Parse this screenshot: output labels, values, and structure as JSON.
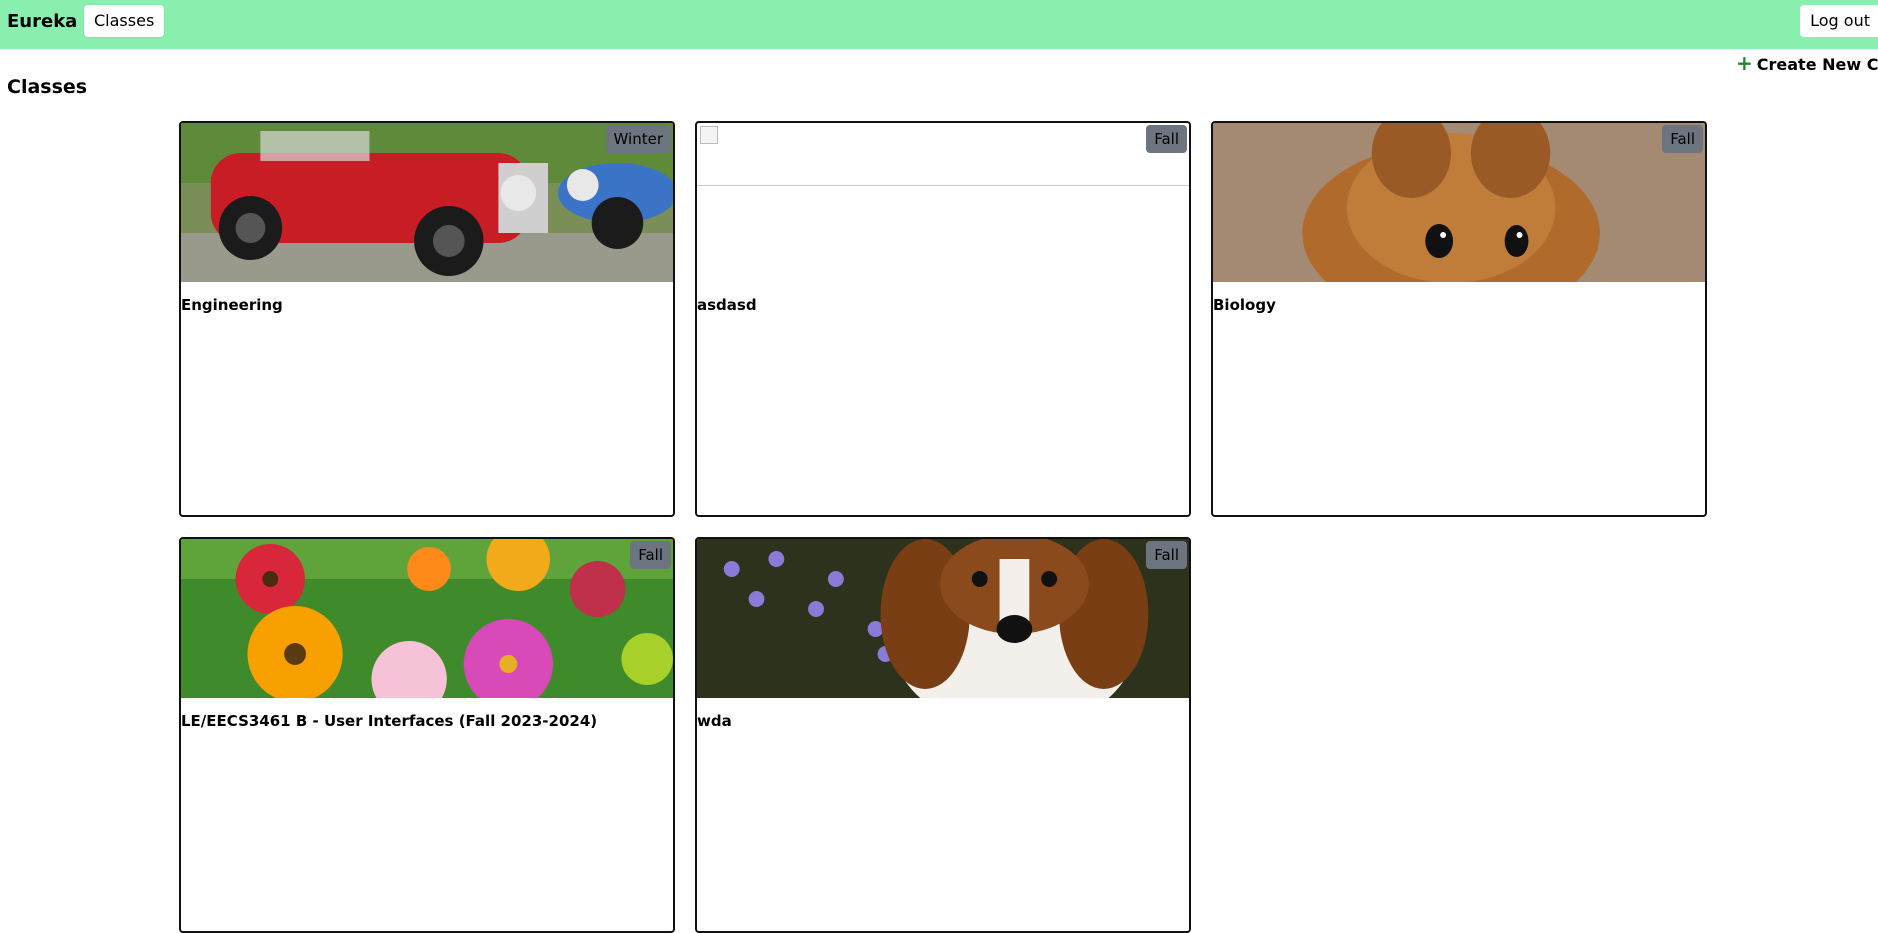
{
  "navbar": {
    "brand": "Eureka",
    "classes_link": "Classes",
    "logout": "Log out",
    "background": "#88efae"
  },
  "toolbar": {
    "create_label": "Create New Class",
    "create_icon": "plus-icon",
    "accent": "#1e8a2f"
  },
  "page": {
    "title": "Classes"
  },
  "cards": [
    {
      "title": "Engineering",
      "term": "Winter",
      "image": "red vintage car"
    },
    {
      "title": "asdasd",
      "term": "Fall",
      "image": "broken image"
    },
    {
      "title": "Biology",
      "term": "Fall",
      "image": "mouse close-up"
    },
    {
      "title": "LE/EECS3461 B - User Interfaces (Fall 2023-2024)",
      "term": "Fall",
      "image": "colorful flowers"
    },
    {
      "title": "wda",
      "term": "Fall",
      "image": "puppy with purple flowers"
    }
  ]
}
